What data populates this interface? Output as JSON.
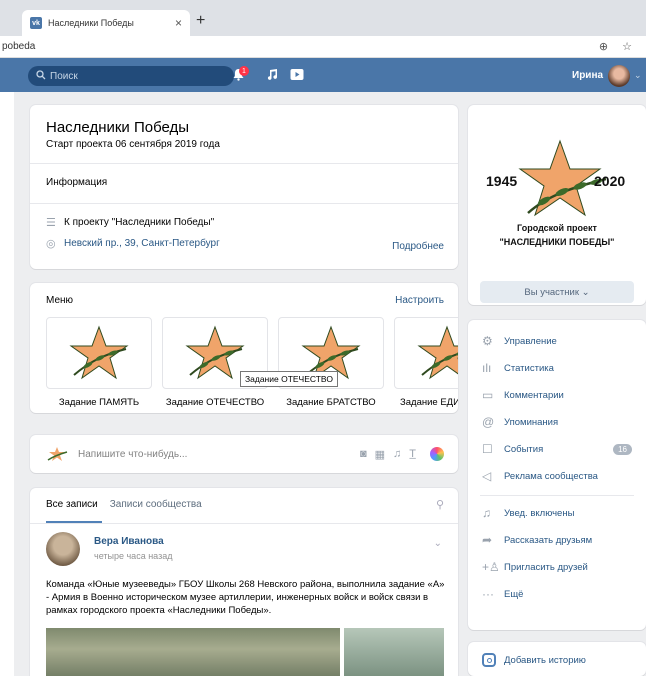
{
  "browser": {
    "tab_title": "Наследники Победы",
    "tab_close": "×",
    "new_tab": "+",
    "url": "pobeda",
    "zoom_icon": "⊕",
    "star_icon": "☆"
  },
  "header": {
    "search_placeholder": "Поиск",
    "notifications_count": "1",
    "user_name": "Ирина"
  },
  "group": {
    "title": "Наследники Победы",
    "subtitle": "Старт проекта 06 сентября 2019 года",
    "info_label": "Информация",
    "about_link": "К проекту \"Наследники Победы\"",
    "address": "Невский пр., 39, Санкт-Петербург",
    "more": "Подробнее"
  },
  "menu": {
    "title": "Меню",
    "configure": "Настроить",
    "items": [
      {
        "label": "Задание ПАМЯТЬ"
      },
      {
        "label": "Задание ОТЕЧЕСТВО"
      },
      {
        "label": "Задание БРАТСТВО"
      },
      {
        "label": "Задание ЕДИ"
      }
    ],
    "tooltip": "Задание ОТЕЧЕСТВО"
  },
  "compose": {
    "placeholder": "Напишите что-нибудь..."
  },
  "posts": {
    "tab_all": "Все записи",
    "tab_community": "Записи сообщества",
    "author": "Вера Иванова",
    "time": "четыре часа назад",
    "text": "Команда «Юные музееведы» ГБОУ Школы 268 Невского района, выполнила задание «А» - Армия в Военно историческом музее артиллерии, инженерных войск и войск связи в рамках городского проекта «Наследники Победы»."
  },
  "cover": {
    "year_start": "1945",
    "year_end": "2020",
    "caption_line1": "Городской проект",
    "caption_line2": "\"НАСЛЕДНИКИ ПОБЕДЫ\"",
    "member_button": "Вы участник ⌄"
  },
  "actions": {
    "manage": "Управление",
    "stats": "Статистика",
    "comments": "Комментарии",
    "mentions": "Упоминания",
    "events": "События",
    "events_count": "16",
    "ads": "Реклама сообщества",
    "notifications": "Увед. включены",
    "tell_friends": "Рассказать друзьям",
    "invite": "Пригласить друзей",
    "more": "Ещё",
    "story": "Добавить историю"
  },
  "colors": {
    "brand": "#4a76a8",
    "link": "#2a5885",
    "star": "#f0a46a"
  }
}
